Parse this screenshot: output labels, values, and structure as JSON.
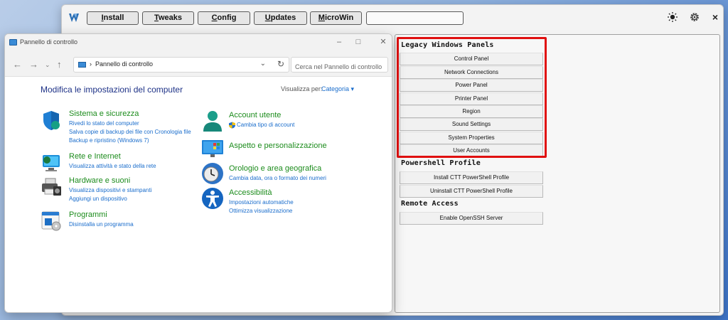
{
  "winutil": {
    "nav": [
      {
        "label_u": "I",
        "label_rest": "nstall"
      },
      {
        "label_u": "T",
        "label_rest": "weaks"
      },
      {
        "label_u": "C",
        "label_rest": "onfig"
      },
      {
        "label_u": "U",
        "label_rest": "pdates"
      },
      {
        "label_u": "M",
        "label_rest": "icroWin"
      }
    ],
    "icons": {
      "logo": "winutil-logo-icon",
      "theme": "sun-icon",
      "settings": "gear-icon",
      "close": "close-icon"
    },
    "close_glyph": "×"
  },
  "control_panel": {
    "window_title": "Pannello di controllo",
    "breadcrumb": "Pannello di controllo",
    "search_placeholder": "Cerca nel Pannello di controllo",
    "heading": "Modifica le impostazioni del computer",
    "view_by_label": "Visualizza per:",
    "view_by_value": "Categoria ▾",
    "categories": [
      {
        "title": "Sistema e sicurezza",
        "links": [
          "Rivedi lo stato del computer",
          "Salva copie di backup dei file con Cronologia file",
          "Backup e ripristino (Windows 7)"
        ]
      },
      {
        "title": "Rete e Internet",
        "links": [
          "Visualizza attività e stato della rete"
        ]
      },
      {
        "title": "Hardware e suoni",
        "links": [
          "Visualizza dispositivi e stampanti",
          "Aggiungi un dispositivo"
        ]
      },
      {
        "title": "Programmi",
        "links": [
          "Disinstalla un programma"
        ]
      },
      {
        "title": "Account utente",
        "links": [
          "Cambia tipo di account"
        ]
      },
      {
        "title": "Aspetto e personalizzazione",
        "links": []
      },
      {
        "title": "Orologio e area geografica",
        "links": [
          "Cambia data, ora o formato dei numeri"
        ]
      },
      {
        "title": "Accessibilità",
        "links": [
          "Impostazioni automatiche",
          "Ottimizza visualizzazione"
        ]
      }
    ]
  },
  "tweak_panel": {
    "legacy_title": "Legacy Windows Panels",
    "legacy_buttons": [
      "Control Panel",
      "Network Connections",
      "Power Panel",
      "Printer Panel",
      "Region",
      "Sound Settings",
      "System Properties",
      "User Accounts"
    ],
    "powershell_title": "Powershell Profile",
    "powershell_buttons": [
      "Install CTT PowerShell Profile",
      "Uninstall CTT PowerShell Profile"
    ],
    "remote_title": "Remote Access",
    "remote_buttons": [
      "Enable OpenSSH Server"
    ],
    "highlight_color": "#e01010"
  }
}
